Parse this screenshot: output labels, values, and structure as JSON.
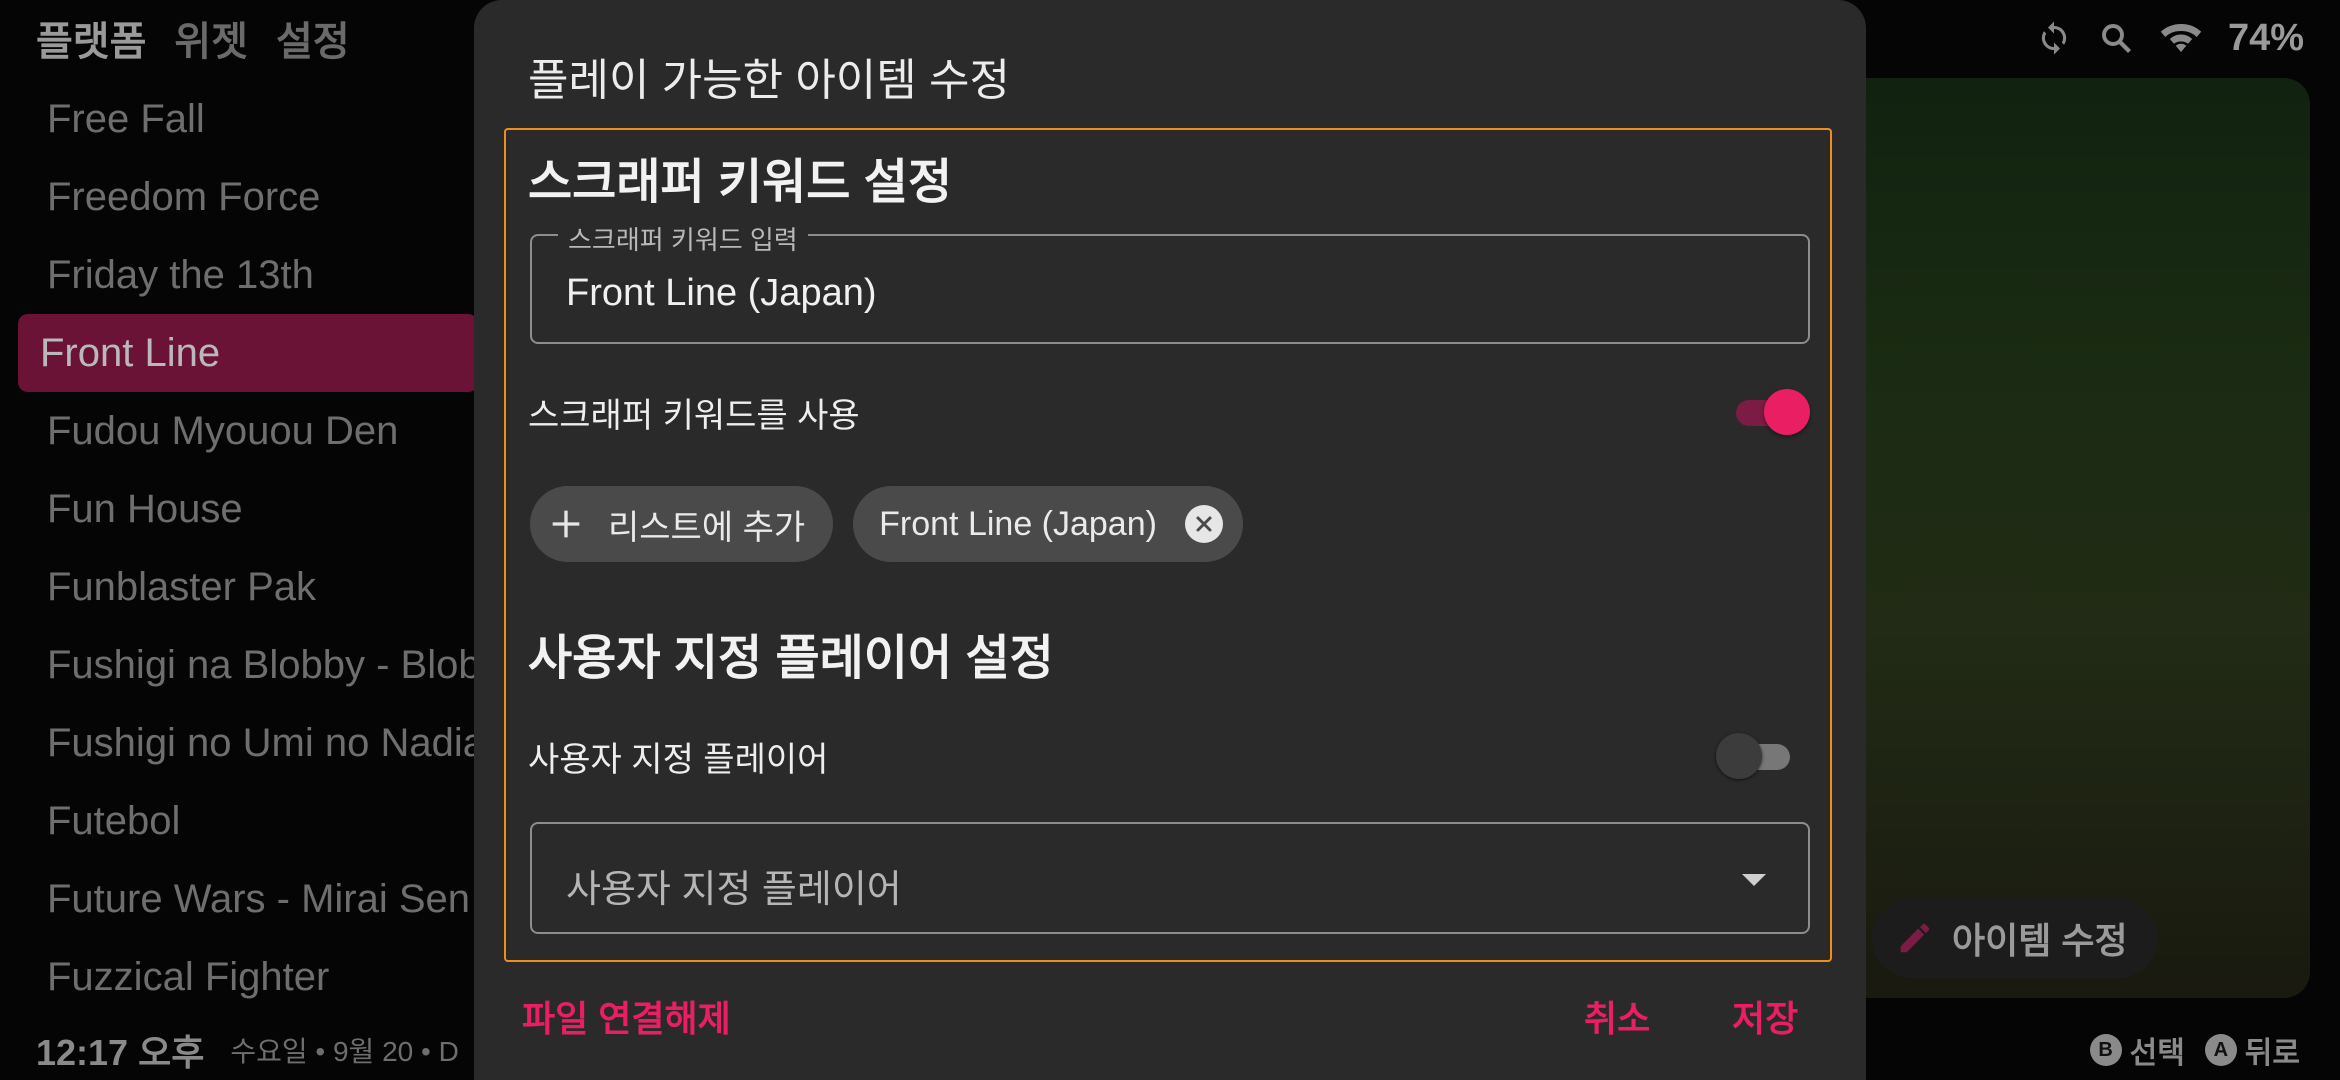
{
  "top_tabs": [
    "플랫폼",
    "위젯",
    "설정"
  ],
  "status": {
    "battery": "74%"
  },
  "games": [
    "Free Fall",
    "Freedom Force",
    "Friday the 13th",
    "Front Line",
    "Fudou Myouou Den",
    "Fun House",
    "Funblaster Pak",
    "Fushigi na Blobby - Blob",
    "Fushigi no Umi no Nadia",
    "Futebol",
    "Future Wars - Mirai Sen",
    "Fuzzical Fighter"
  ],
  "selected_game": "Front Line",
  "edit_item_label": "아이템 수정",
  "bottom": {
    "clock": "12:17 오후",
    "date": "수요일 • 9월 20 • D",
    "hint_b_key": "B",
    "hint_b": "선택",
    "hint_a_key": "A",
    "hint_a": "뒤로"
  },
  "dialog": {
    "title": "플레이 가능한 아이템 수정",
    "scraper": {
      "section_title": "스크래퍼 키워드 설정",
      "input_label": "스크래퍼 키워드 입력",
      "input_value": "Front Line (Japan)",
      "toggle_label": "스크래퍼 키워드를 사용",
      "toggle_on": true,
      "add_chip_label": "리스트에 추가",
      "keyword_chip": "Front Line (Japan)"
    },
    "player": {
      "section_title": "사용자 지정 플레이어 설정",
      "toggle_label": "사용자 지정 플레이어",
      "toggle_on": false,
      "select_value": "사용자 지정 플레이어"
    },
    "actions": {
      "unlink": "파일 연결해제",
      "cancel": "취소",
      "save": "저장"
    }
  },
  "colors": {
    "accent": "#e91e63",
    "focus_border": "#f28c1a",
    "selected_row": "#6a1336"
  }
}
